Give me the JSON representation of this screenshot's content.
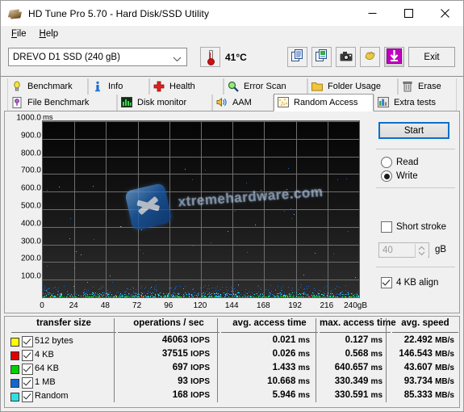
{
  "window": {
    "title": "HD Tune Pro 5.70 - Hard Disk/SSD Utility",
    "icon": "hdtune-app-icon",
    "minimize": "minimize-icon",
    "maximize": "maximize-icon",
    "close": "close-icon"
  },
  "menu": {
    "items": [
      {
        "label": "File",
        "accel": "F"
      },
      {
        "label": "Help",
        "accel": "H"
      }
    ]
  },
  "toolbar": {
    "drive": "DREVO D1 SSD (240 gB)",
    "drive_dropdown_icon": "chevron-down-icon",
    "temperature": "41°C",
    "thermometer_icon": "thermometer-icon",
    "buttons": [
      {
        "name": "copy-text-button",
        "icon": "copy-text-icon"
      },
      {
        "name": "copy-image-button",
        "icon": "copy-image-icon"
      },
      {
        "name": "screenshot-button",
        "icon": "camera-icon"
      },
      {
        "name": "options-button",
        "icon": "hand-icon"
      },
      {
        "name": "download-button",
        "icon": "download-arrow-icon"
      }
    ],
    "exit_label": "Exit"
  },
  "tabs": {
    "row1": [
      {
        "label": "Benchmark",
        "icon": "lightbulb-icon",
        "active": false
      },
      {
        "label": "Info",
        "icon": "info-icon",
        "active": false
      },
      {
        "label": "Health",
        "icon": "red-cross-icon",
        "active": false
      },
      {
        "label": "Error Scan",
        "icon": "magnifier-icon",
        "active": false
      },
      {
        "label": "Folder Usage",
        "icon": "folder-icon",
        "active": false
      },
      {
        "label": "Erase",
        "icon": "trash-icon",
        "active": false
      }
    ],
    "row2": [
      {
        "label": "File Benchmark",
        "icon": "file-benchmark-icon",
        "active": false
      },
      {
        "label": "Disk monitor",
        "icon": "bar-chart-icon",
        "active": false
      },
      {
        "label": "AAM",
        "icon": "speaker-icon",
        "active": false
      },
      {
        "label": "Random Access",
        "icon": "scatter-icon",
        "active": true
      },
      {
        "label": "Extra tests",
        "icon": "extra-tests-icon",
        "active": false
      }
    ]
  },
  "controls": {
    "start_label": "Start",
    "mode_read_label": "Read",
    "mode_write_label": "Write",
    "mode_selected": "Write",
    "short_stroke_label": "Short stroke",
    "short_stroke_checked": false,
    "short_stroke_value": "40",
    "short_stroke_unit": "gB",
    "align_label": "4 KB align",
    "align_checked": true,
    "accent_color": "#0b6fc9"
  },
  "chart_data": {
    "type": "scatter",
    "title": "",
    "xlabel": "",
    "ylabel": "ms",
    "y_unit_label": "ms",
    "x_unit_label": "gB",
    "xlim": [
      0,
      240
    ],
    "ylim": [
      0,
      1000
    ],
    "xticks": [
      0,
      24,
      48,
      72,
      96,
      120,
      144,
      168,
      192,
      216,
      240
    ],
    "xticklabels": [
      "0",
      "24",
      "48",
      "72",
      "96",
      "120",
      "144",
      "168",
      "192",
      "216",
      "240gB"
    ],
    "yticks": [
      100,
      200,
      300,
      400,
      500,
      600,
      700,
      800,
      900,
      1000
    ],
    "yticklabels": [
      "100.0",
      "200.0",
      "300.0",
      "400.0",
      "500.0",
      "600.0",
      "700.0",
      "800.0",
      "900.0",
      "1000.0"
    ],
    "grid": true,
    "background": "#0b0b0b",
    "watermark": "xtremehardware.com",
    "series": [
      {
        "name": "512 bytes",
        "color": "#ffff00",
        "marker_count": 40,
        "y_band": [
          0,
          6
        ]
      },
      {
        "name": "4 KB",
        "color": "#e00000",
        "marker_count": 30,
        "y_band": [
          0,
          8
        ]
      },
      {
        "name": "64 KB",
        "color": "#00c000",
        "marker_count": 260,
        "y_band": [
          2,
          16
        ]
      },
      {
        "name": "1 MB",
        "color": "#1466d0",
        "marker_count": 300,
        "y_band": [
          18,
          70
        ]
      },
      {
        "name": "Random",
        "color": "#2fe0e0",
        "marker_count": 420,
        "y_band": [
          2,
          30
        ]
      }
    ]
  },
  "results": {
    "columns": [
      "transfer size",
      "operations / sec",
      "avg. access time",
      "max. access time",
      "avg. speed"
    ],
    "rows": [
      {
        "color": "#ffff00",
        "label": "512 bytes",
        "checked": true,
        "iops": "46063 IOPS",
        "avg_access": "0.021 ms",
        "max_access": "0.127 ms",
        "avg_speed": "22.492 MB/s"
      },
      {
        "color": "#e00000",
        "label": "4 KB",
        "checked": true,
        "iops": "37515 IOPS",
        "avg_access": "0.026 ms",
        "max_access": "0.568 ms",
        "avg_speed": "146.543 MB/s"
      },
      {
        "color": "#00d000",
        "label": "64 KB",
        "checked": true,
        "iops": "697 IOPS",
        "avg_access": "1.433 ms",
        "max_access": "640.657 ms",
        "avg_speed": "43.607 MB/s"
      },
      {
        "color": "#1466d0",
        "label": "1 MB",
        "checked": true,
        "iops": "93 IOPS",
        "avg_access": "10.668 ms",
        "max_access": "330.349 ms",
        "avg_speed": "93.734 MB/s"
      },
      {
        "color": "#2fe0e0",
        "label": "Random",
        "checked": true,
        "iops": "168 IOPS",
        "avg_access": "5.946 ms",
        "max_access": "330.591 ms",
        "avg_speed": "85.333 MB/s"
      }
    ]
  }
}
